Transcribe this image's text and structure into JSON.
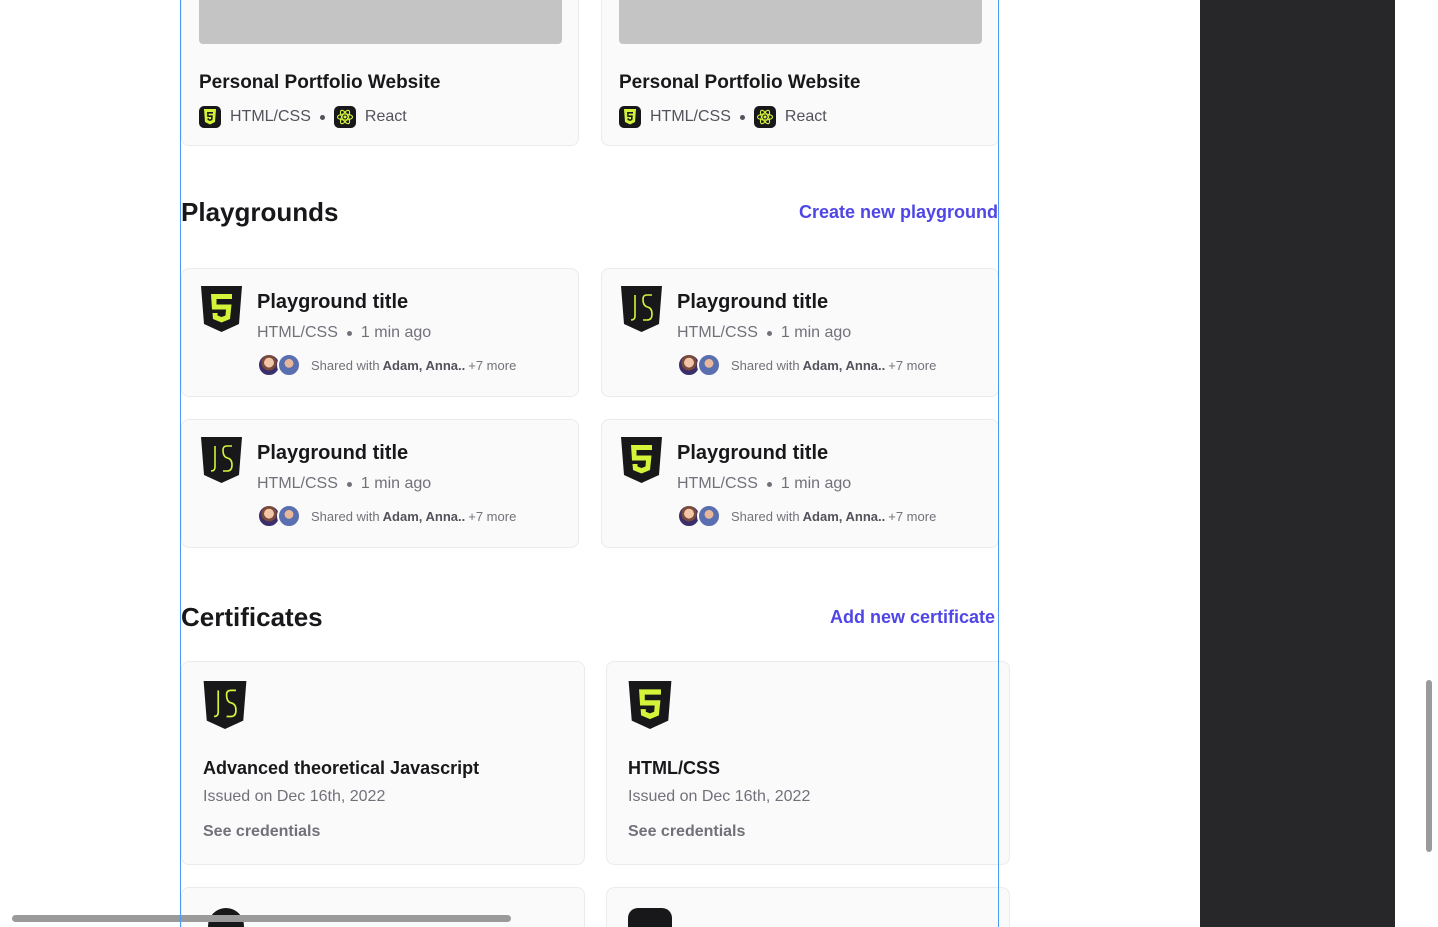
{
  "projects": [
    {
      "title": "Personal Portfolio Website",
      "tag1": "HTML/CSS",
      "tag2": "React"
    },
    {
      "title": "Personal Portfolio Website",
      "tag1": "HTML/CSS",
      "tag2": "React"
    }
  ],
  "playgrounds": {
    "heading": "Playgrounds",
    "action": "Create new playground",
    "items": [
      {
        "icon": "html5-icon",
        "title": "Playground title",
        "lang": "HTML/CSS",
        "time": "1 min ago",
        "shared_prefix": "Shared with",
        "shared_names": "Adam, Anna..",
        "shared_more": "+7 more"
      },
      {
        "icon": "js-icon",
        "title": "Playground title",
        "lang": "HTML/CSS",
        "time": "1 min ago",
        "shared_prefix": "Shared with",
        "shared_names": "Adam, Anna..",
        "shared_more": "+7 more"
      },
      {
        "icon": "js-icon",
        "title": "Playground title",
        "lang": "HTML/CSS",
        "time": "1 min ago",
        "shared_prefix": "Shared with",
        "shared_names": "Adam, Anna..",
        "shared_more": "+7 more"
      },
      {
        "icon": "html5-icon",
        "title": "Playground title",
        "lang": "HTML/CSS",
        "time": "1 min ago",
        "shared_prefix": "Shared with",
        "shared_names": "Adam, Anna..",
        "shared_more": "+7 more"
      }
    ]
  },
  "certificates": {
    "heading": "Certificates",
    "action": "Add new certificate",
    "items": [
      {
        "icon": "js-icon",
        "title": "Advanced theoretical Javascript",
        "issued": "Issued on Dec 16th, 2022",
        "link": "See credentials"
      },
      {
        "icon": "html5-icon",
        "title": "HTML/CSS",
        "issued": "Issued on Dec 16th, 2022",
        "link": "See credentials"
      }
    ]
  },
  "colors": {
    "accent": "#4f46e5",
    "logo_fill": "#d4f43a",
    "logo_bg": "#18181b"
  }
}
